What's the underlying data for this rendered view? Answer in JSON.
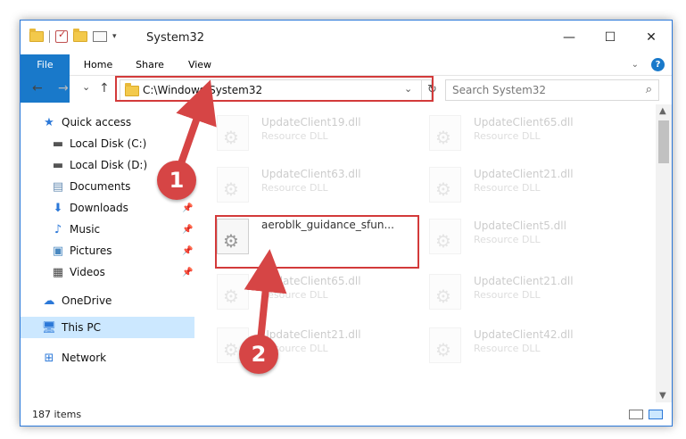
{
  "window": {
    "title": "System32"
  },
  "ribbon": {
    "tabs": [
      "File",
      "Home",
      "Share",
      "View"
    ],
    "help": "?"
  },
  "nav": {
    "back": "←",
    "forward": "→",
    "recent": "⌄",
    "up": "↑",
    "address": "C:\\Windows\\System32",
    "dropdown": "⌄",
    "refresh": "↻",
    "search_placeholder": "Search System32"
  },
  "sidebar": {
    "items": [
      {
        "label": "Quick access",
        "icon": "star-icon"
      },
      {
        "label": "Local Disk (C:)",
        "icon": "drive-icon"
      },
      {
        "label": "Local Disk (D:)",
        "icon": "drive-icon"
      },
      {
        "label": "Documents",
        "icon": "documents-icon"
      },
      {
        "label": "Downloads",
        "icon": "download-icon"
      },
      {
        "label": "Music",
        "icon": "music-icon"
      },
      {
        "label": "Pictures",
        "icon": "pictures-icon"
      },
      {
        "label": "Videos",
        "icon": "videos-icon"
      },
      {
        "label": "OneDrive",
        "icon": "cloud-icon"
      },
      {
        "label": "This PC",
        "icon": "computer-icon"
      },
      {
        "label": "Network",
        "icon": "network-icon"
      }
    ]
  },
  "files": [
    {
      "name": "UpdateClient19.dll",
      "type": "Resource DLL"
    },
    {
      "name": "UpdateClient65.dll",
      "type": "Resource DLL"
    },
    {
      "name": "UpdateClient63.dll",
      "type": "Resource DLL"
    },
    {
      "name": "UpdateClient21.dll",
      "type": "Resource DLL"
    },
    {
      "name": "aeroblk_guidance_sfun...",
      "type": ""
    },
    {
      "name": "UpdateClient5.dll",
      "type": "Resource DLL"
    },
    {
      "name": "UpdateClient65.dll",
      "type": "Resource DLL"
    },
    {
      "name": "UpdateClient21.dll",
      "type": "Resource DLL"
    },
    {
      "name": "UpdateClient21.dll",
      "type": "Resource DLL"
    },
    {
      "name": "UpdateClient42.dll",
      "type": "Resource DLL"
    }
  ],
  "status": {
    "count": "187 items"
  },
  "annotations": {
    "badge1": "1",
    "badge2": "2",
    "color": "#d64545"
  }
}
